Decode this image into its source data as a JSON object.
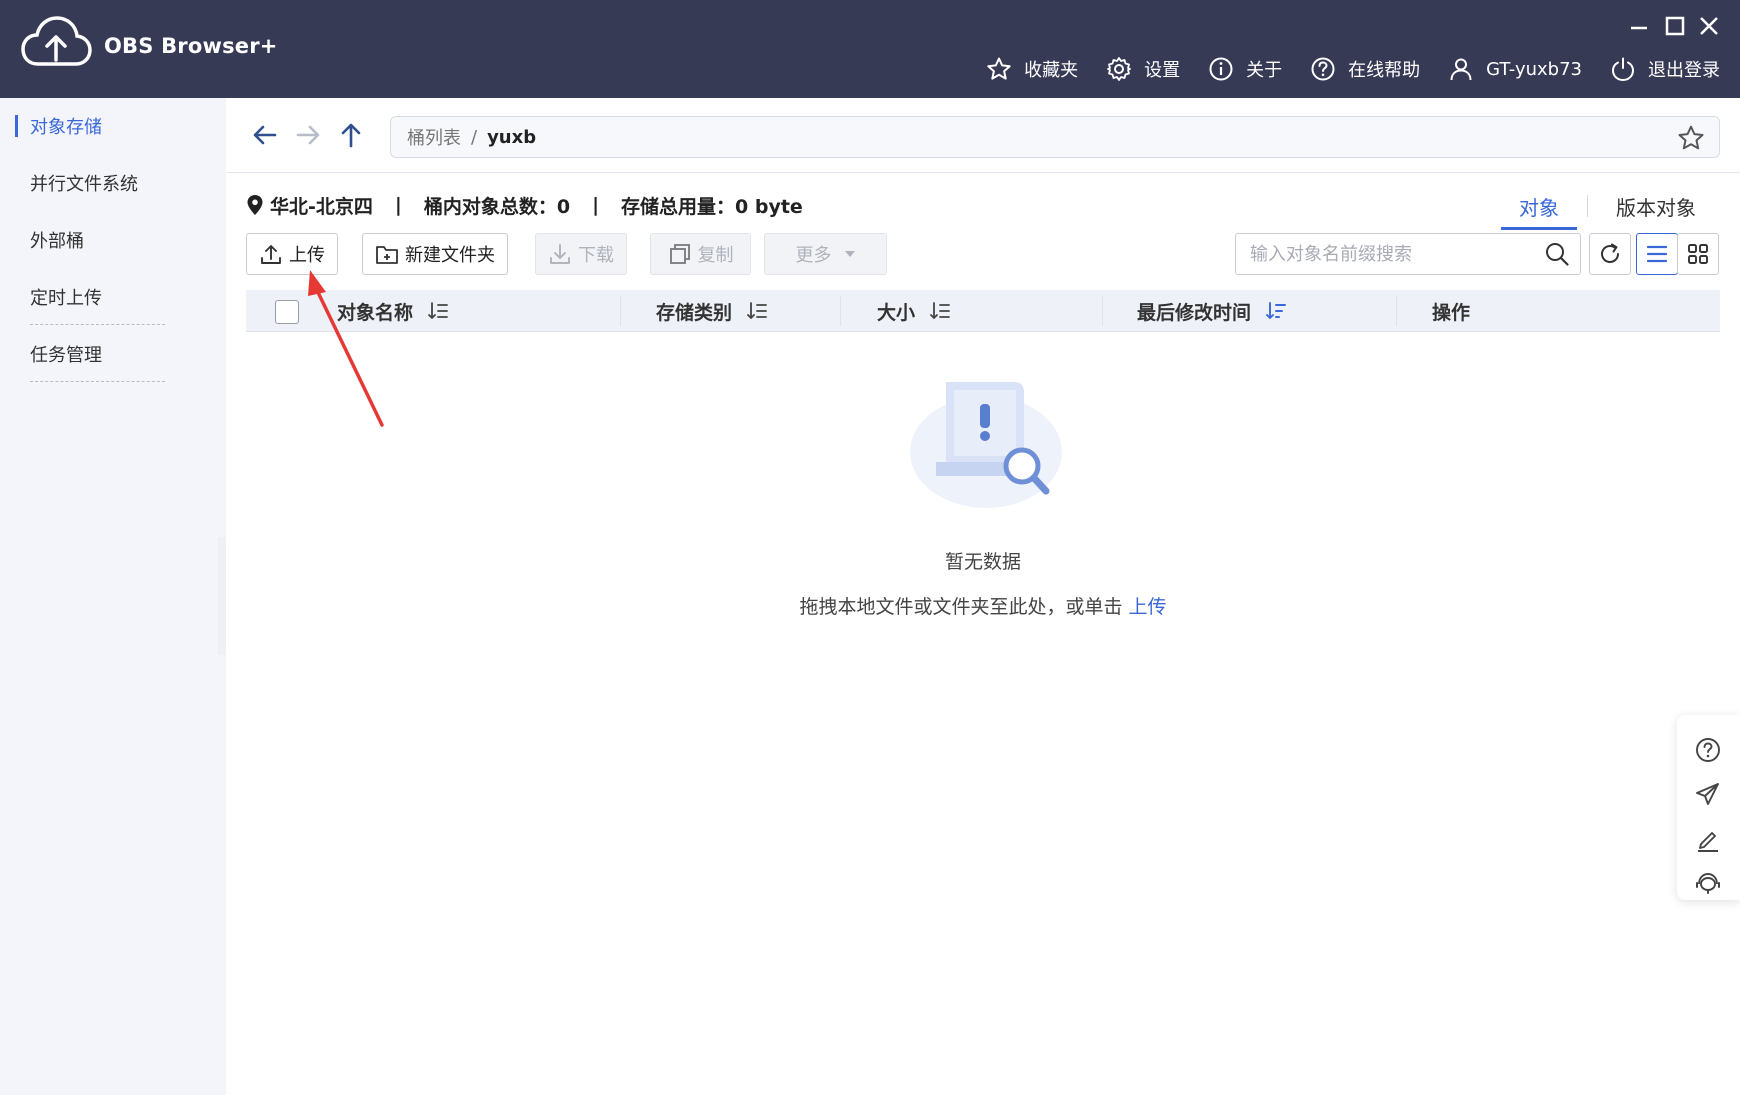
{
  "app": {
    "name": "OBS Browser+"
  },
  "top_nav": {
    "favorites": "收藏夹",
    "settings": "设置",
    "about": "关于",
    "online_help": "在线帮助",
    "user": "GT-yuxb73",
    "logout": "退出登录"
  },
  "sidebar": {
    "items": [
      {
        "label": "对象存储"
      },
      {
        "label": "并行文件系统"
      },
      {
        "label": "外部桶"
      },
      {
        "label": "定时上传"
      },
      {
        "label": "任务管理"
      }
    ]
  },
  "address_bar": {
    "root": "桶列表",
    "separator": "/",
    "current": "yuxb"
  },
  "bucket_info": {
    "region": "华北-北京四",
    "separator": "|",
    "object_count": "桶内对象总数：0",
    "storage_used": "存储总用量：0 byte"
  },
  "view_tabs": {
    "objects": "对象",
    "versions": "版本对象"
  },
  "toolbar": {
    "upload": "上传",
    "new_folder": "新建文件夹",
    "download": "下载",
    "copy": "复制",
    "more": "更多"
  },
  "search": {
    "placeholder": "输入对象名前缀搜索"
  },
  "table": {
    "columns": [
      "对象名称",
      "存储类别",
      "大小",
      "最后修改时间",
      "操作"
    ]
  },
  "empty": {
    "title": "暂无数据",
    "hint": "拖拽本地文件或文件夹至此处，或单击",
    "hint_link": "上传"
  },
  "icons": {
    "logo": "cloud-upload-icon",
    "favorites": "star-icon",
    "settings": "gear-icon",
    "about": "info-icon",
    "help": "question-icon",
    "user": "user-icon",
    "logout": "power-icon"
  },
  "colors": {
    "titlebar": "#373a55",
    "accent": "#3a68d8",
    "annotation_arrow": "#e53935"
  }
}
